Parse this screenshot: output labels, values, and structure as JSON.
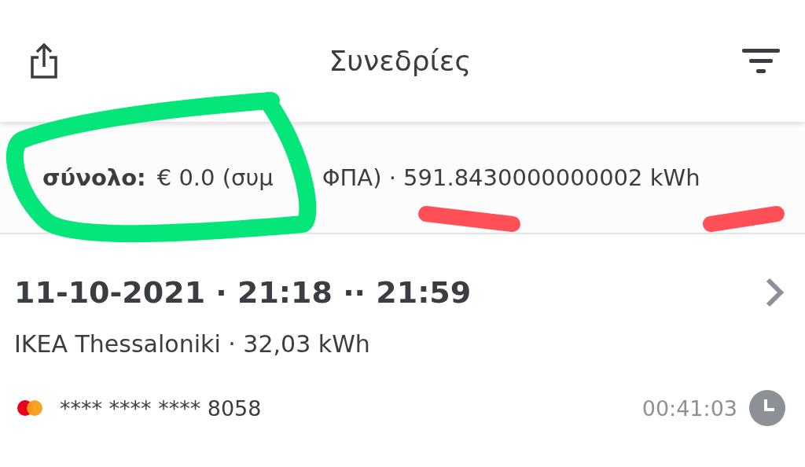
{
  "header": {
    "title": "Συνεδρίες"
  },
  "summary": {
    "label": "σύνολο:",
    "amount": "€ 0.0 (συμ",
    "rest": "ΦΠΑ) · 591.8430000000002 kWh"
  },
  "sessions": [
    {
      "datetime": "11-10-2021 · 21:18 ·· 21:59",
      "location": "IKEA Thessaloniki",
      "energy": " · 32,03 kWh",
      "card": "**** **** **** 8058",
      "duration": "00:41:03"
    }
  ]
}
